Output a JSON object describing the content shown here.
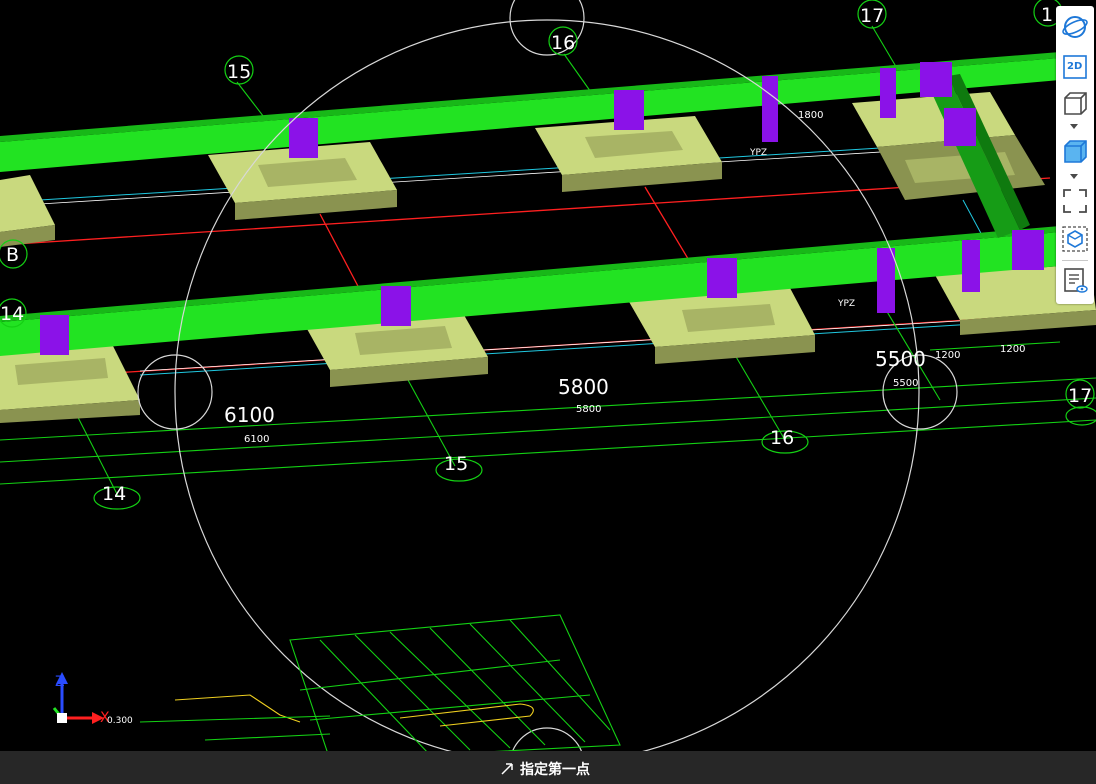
{
  "viewport": {
    "axes": {
      "x_label": "X",
      "z_label": "Z",
      "origin_value": "0.300"
    },
    "grid_labels": {
      "top": [
        "15",
        "16",
        "17",
        "1"
      ],
      "row": [
        "B"
      ],
      "left": [
        "14"
      ],
      "bottom": [
        "14",
        "15",
        "16",
        "17"
      ],
      "bottom_small": [
        "14",
        "15",
        "16",
        "17"
      ]
    },
    "dimensions_large": [
      "6100",
      "5800",
      "5500"
    ],
    "dimensions_small": [
      "6100",
      "5800",
      "5500",
      "1200",
      "1200",
      "1800"
    ],
    "labels": [
      "YPZ",
      "YPZ"
    ],
    "colors": {
      "beam": "#22e322",
      "beam_dark": "#169c16",
      "column": "#8b12e8",
      "footing_top": "#c9d97e",
      "footing_side": "#8a9350",
      "axis_red": "#ff2020",
      "axis_cyan": "#20c8e0",
      "grid_green": "#14d014"
    }
  },
  "toolbar": {
    "items": [
      {
        "name": "orbit",
        "icon": "orbit-icon"
      },
      {
        "name": "2d",
        "icon": "2d-view-icon",
        "text": "2D"
      },
      {
        "name": "3d-wire",
        "icon": "wireframe-cube-icon"
      },
      {
        "name": "3d-shaded",
        "icon": "shaded-cube-icon"
      },
      {
        "name": "fullscreen",
        "icon": "fullscreen-icon"
      },
      {
        "name": "view-box",
        "icon": "view-cube-icon"
      },
      {
        "name": "properties",
        "icon": "properties-view-icon"
      }
    ]
  },
  "status": {
    "prompt": "指定第一点"
  }
}
